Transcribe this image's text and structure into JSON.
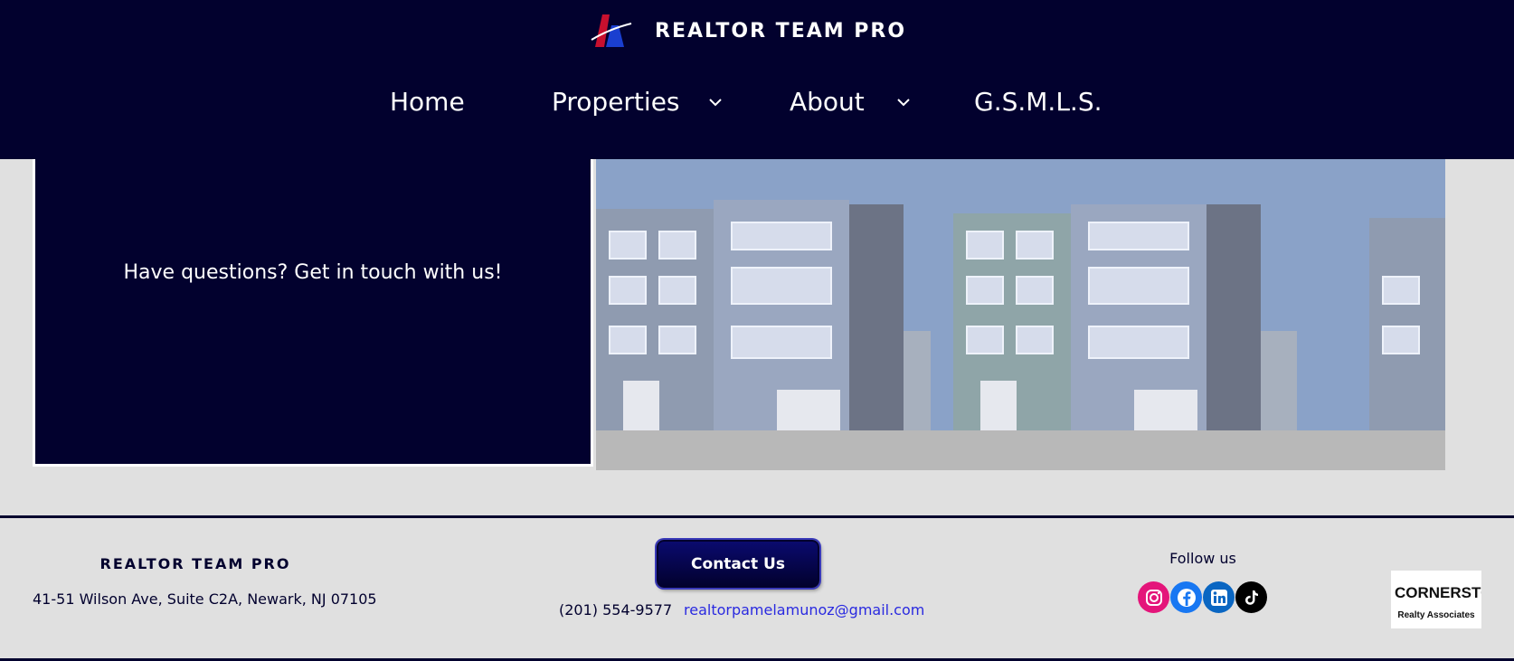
{
  "header": {
    "brand_name": "REALTOR TEAM PRO",
    "nav": [
      {
        "label": "Home",
        "has_dropdown": false
      },
      {
        "label": "Properties",
        "has_dropdown": true
      },
      {
        "label": "About",
        "has_dropdown": true
      },
      {
        "label": "G.S.M.L.S.",
        "has_dropdown": false
      }
    ]
  },
  "main": {
    "cta_text": "Have questions? Get in touch with us!"
  },
  "footer": {
    "brand_name": "REALTOR TEAM PRO",
    "address": "41-51 Wilson Ave, Suite C2A, Newark, NJ 07105",
    "contact_button": "Contact Us",
    "phone": "(201) 554-9577",
    "email": "realtorpamelamunoz@gmail.com",
    "follow_label": "Follow us",
    "social": [
      "instagram-icon",
      "facebook-icon",
      "linkedin-icon",
      "tiktok-icon"
    ],
    "partner_logo": {
      "line1": "CORNERSTONE",
      "line2": "Realty Associates"
    }
  },
  "colors": {
    "navy": "#02012e",
    "background": "#e0e0e0",
    "link": "#2a2ae0",
    "instagram": "#e4157a",
    "facebook": "#1877f2",
    "linkedin": "#0a66c2",
    "tiktok": "#000000"
  }
}
